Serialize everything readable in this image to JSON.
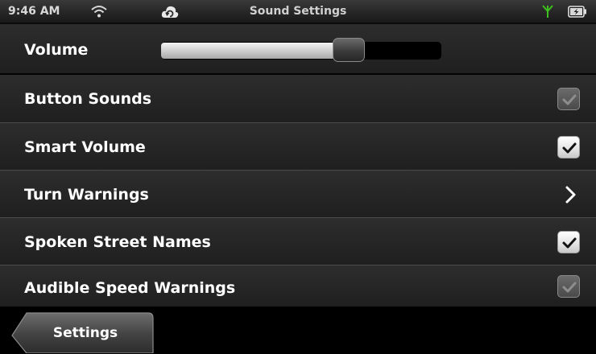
{
  "status_bar": {
    "time": "9:46 AM",
    "title": "Sound Settings",
    "icons": [
      "wifi-icon",
      "sync-cloud-icon",
      "signal-antenna-icon",
      "battery-charging-icon"
    ],
    "signal_color": "#3fbf1f"
  },
  "volume": {
    "label": "Volume",
    "level": 0.67
  },
  "settings": [
    {
      "label": "Button Sounds",
      "control": "checkbox",
      "checked": true,
      "enabled": false
    },
    {
      "label": "Smart Volume",
      "control": "checkbox",
      "checked": true,
      "enabled": true
    },
    {
      "label": "Turn Warnings",
      "control": "chevron-right-icon"
    },
    {
      "label": "Spoken Street Names",
      "control": "checkbox",
      "checked": true,
      "enabled": true
    },
    {
      "label": "Audible Speed Warnings",
      "control": "checkbox",
      "checked": true,
      "enabled": false
    }
  ],
  "bottom_bar": {
    "back_label": "Settings"
  }
}
